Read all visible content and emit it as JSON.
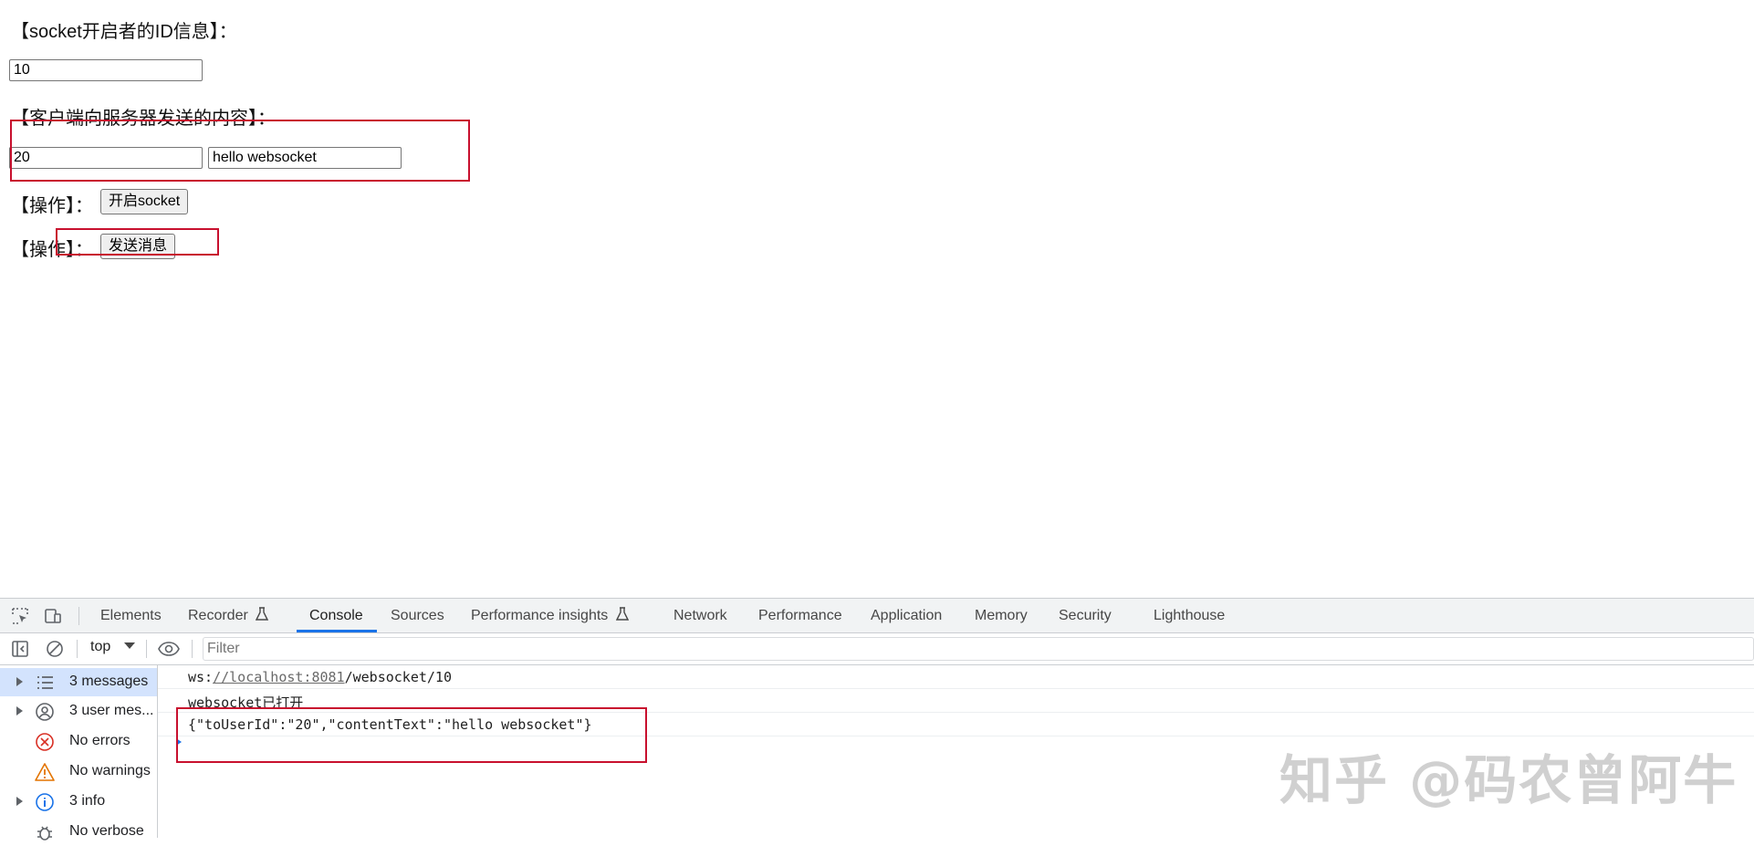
{
  "page": {
    "socket_id_label": "【socket开启者的ID信息】：",
    "socket_id_value": "10",
    "client_content_label": "【客户端向服务器发送的内容】：",
    "to_user_id_value": "20",
    "content_text_value": "hello websocket",
    "operation_label_1": "【操作】：",
    "open_socket_button": "开启socket",
    "operation_label_2": "【操作】：",
    "send_message_button": "发送消息",
    "annotation_color": "#c8102e"
  },
  "devtools": {
    "tabs": [
      {
        "label": "Elements"
      },
      {
        "label": "Recorder"
      },
      {
        "label": "Console",
        "active": true
      },
      {
        "label": "Sources"
      },
      {
        "label": "Performance insights"
      },
      {
        "label": "Network"
      },
      {
        "label": "Performance"
      },
      {
        "label": "Application"
      },
      {
        "label": "Memory"
      },
      {
        "label": "Security"
      },
      {
        "label": "Lighthouse"
      }
    ],
    "context_selector": "top",
    "filter_placeholder": "Filter",
    "sidebar": [
      {
        "label": "3 messages",
        "icon": "list-icon",
        "selected": true
      },
      {
        "label": "3 user mes...",
        "icon": "user-icon"
      },
      {
        "label": "No errors",
        "icon": "error-icon"
      },
      {
        "label": "No warnings",
        "icon": "warning-icon"
      },
      {
        "label": "3 info",
        "icon": "info-icon"
      },
      {
        "label": "No verbose",
        "icon": "bug-icon"
      }
    ],
    "console_logs": [
      {
        "prefix": "ws:",
        "link": "//localhost:8081",
        "suffix": "/websocket/10"
      },
      {
        "text": "websocket已打开"
      },
      {
        "text": "{\"toUserId\":\"20\",\"contentText\":\"hello websocket\"}"
      }
    ],
    "accent_color": "#1a73e8"
  },
  "watermark": "知乎 @码农曾阿牛"
}
